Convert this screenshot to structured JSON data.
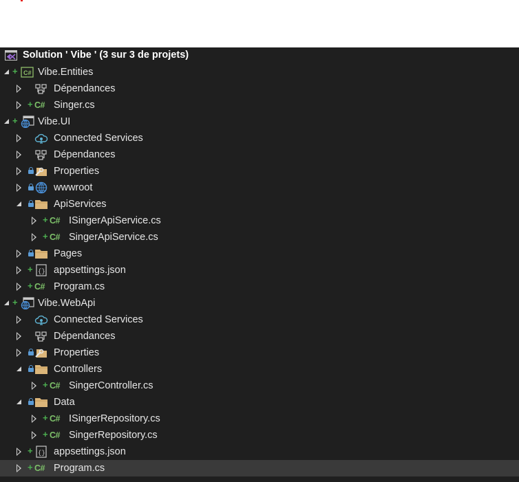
{
  "solution": {
    "label": "Solution ' Vibe ' (3 sur 3 de projets)"
  },
  "rows": [
    {
      "level": 0,
      "label": "Vibe.Entities",
      "icon": "csharp-project-icon",
      "expand": "open",
      "plus": true,
      "lock": false
    },
    {
      "level": 1,
      "label": "Dépendances",
      "icon": "dependencies-icon",
      "expand": "closed",
      "plus": false,
      "lock": false
    },
    {
      "level": 1,
      "label": "Singer.cs",
      "icon": "csharp-file-icon",
      "expand": "closed",
      "plus": true,
      "lock": false
    },
    {
      "level": 0,
      "label": "Vibe.UI",
      "icon": "web-project-icon",
      "expand": "open",
      "plus": true,
      "lock": false
    },
    {
      "level": 1,
      "label": "Connected Services",
      "icon": "connected-services-icon",
      "expand": "closed",
      "plus": false,
      "lock": false
    },
    {
      "level": 1,
      "label": "Dépendances",
      "icon": "dependencies-icon",
      "expand": "closed",
      "plus": false,
      "lock": false
    },
    {
      "level": 1,
      "label": "Properties",
      "icon": "properties-icon",
      "expand": "closed",
      "plus": false,
      "lock": true
    },
    {
      "level": 1,
      "label": "wwwroot",
      "icon": "globe-icon",
      "expand": "closed",
      "plus": false,
      "lock": true
    },
    {
      "level": 1,
      "label": "ApiServices",
      "icon": "folder-icon",
      "expand": "open",
      "plus": false,
      "lock": true
    },
    {
      "level": 2,
      "label": "ISingerApiService.cs",
      "icon": "csharp-file-icon",
      "expand": "closed",
      "plus": true,
      "lock": false
    },
    {
      "level": 2,
      "label": "SingerApiService.cs",
      "icon": "csharp-file-icon",
      "expand": "closed",
      "plus": true,
      "lock": false
    },
    {
      "level": 1,
      "label": "Pages",
      "icon": "folder-icon",
      "expand": "closed",
      "plus": false,
      "lock": true
    },
    {
      "level": 1,
      "label": "appsettings.json",
      "icon": "json-file-icon",
      "expand": "closed",
      "plus": true,
      "lock": false
    },
    {
      "level": 1,
      "label": "Program.cs",
      "icon": "csharp-file-icon",
      "expand": "closed",
      "plus": true,
      "lock": false
    },
    {
      "level": 0,
      "label": "Vibe.WebApi",
      "icon": "web-project-icon",
      "expand": "open",
      "plus": true,
      "lock": false
    },
    {
      "level": 1,
      "label": "Connected Services",
      "icon": "connected-services-icon",
      "expand": "closed",
      "plus": false,
      "lock": false
    },
    {
      "level": 1,
      "label": "Dépendances",
      "icon": "dependencies-icon",
      "expand": "closed",
      "plus": false,
      "lock": false
    },
    {
      "level": 1,
      "label": "Properties",
      "icon": "properties-icon",
      "expand": "closed",
      "plus": false,
      "lock": true
    },
    {
      "level": 1,
      "label": "Controllers",
      "icon": "folder-icon",
      "expand": "open",
      "plus": false,
      "lock": true
    },
    {
      "level": 2,
      "label": "SingerController.cs",
      "icon": "csharp-file-icon",
      "expand": "closed",
      "plus": true,
      "lock": false
    },
    {
      "level": 1,
      "label": "Data",
      "icon": "folder-icon",
      "expand": "open",
      "plus": false,
      "lock": true
    },
    {
      "level": 2,
      "label": "ISingerRepository.cs",
      "icon": "csharp-file-icon",
      "expand": "closed",
      "plus": true,
      "lock": false
    },
    {
      "level": 2,
      "label": "SingerRepository.cs",
      "icon": "csharp-file-icon",
      "expand": "closed",
      "plus": true,
      "lock": false
    },
    {
      "level": 1,
      "label": "appsettings.json",
      "icon": "json-file-icon",
      "expand": "closed",
      "plus": true,
      "lock": false
    },
    {
      "level": 1,
      "label": "Program.cs",
      "icon": "csharp-file-icon",
      "expand": "closed",
      "plus": true,
      "lock": false,
      "selected": true
    }
  ],
  "text": {
    "plus_sign": "+",
    "csharp_glyph": "C#"
  },
  "colors": {
    "background": "#1f1f1f",
    "selected_row": "#3a3a3a",
    "plus": "#4caf50",
    "lock": "#5b9bd5",
    "folder": "#dcb67a",
    "csharp": "#7ec16a"
  }
}
